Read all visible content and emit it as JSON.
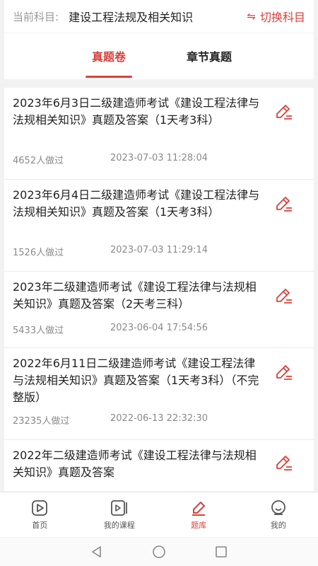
{
  "subject": {
    "label": "当前科目:",
    "name": "建设工程法规及相关知识",
    "switch_icon": "swap-icon",
    "switch_label": "切换科目"
  },
  "tabs": [
    {
      "label": "真题卷",
      "active": true
    },
    {
      "label": "章节真题",
      "active": false
    }
  ],
  "items": [
    {
      "title": "2023年6月3日二级建造师考试《建设工程法律与法规相关知识》真题及答案（1天考3科）",
      "done": "4652人做过",
      "time": "2023-07-03 11:28:04"
    },
    {
      "title": "2023年6月4日二级建造师考试《建设工程法律与法规相关知识》真题及答案（1天考3科）",
      "done": "1526人做过",
      "time": "2023-07-03 11:29:14"
    },
    {
      "title": "2023年二级建造师考试《建设工程法律与法规相关知识》真题及答案（2天考三科）",
      "done": "5433人做过",
      "time": "2023-06-04 17:54:56"
    },
    {
      "title": "2022年6月11日二级建造师考试《建设工程法律与法规相关知识》真题及答案（1天考3科）（不完整版）",
      "done": "23235人做过",
      "time": "2022-06-13 22:32:30"
    },
    {
      "title": "2022年二级建造师考试《建设工程法律与法规相关知识》真题及答案",
      "done": "",
      "time": ""
    }
  ],
  "nav": [
    {
      "label": "首页",
      "icon": "home-icon",
      "active": false
    },
    {
      "label": "我的课程",
      "icon": "course-icon",
      "active": false
    },
    {
      "label": "题库",
      "icon": "question-bank-icon",
      "active": true
    },
    {
      "label": "我的",
      "icon": "profile-icon",
      "active": false
    }
  ],
  "colors": {
    "accent": "#d9403a",
    "text": "#222222",
    "muted": "#8a8a8a",
    "background": "#f2f2f2"
  }
}
